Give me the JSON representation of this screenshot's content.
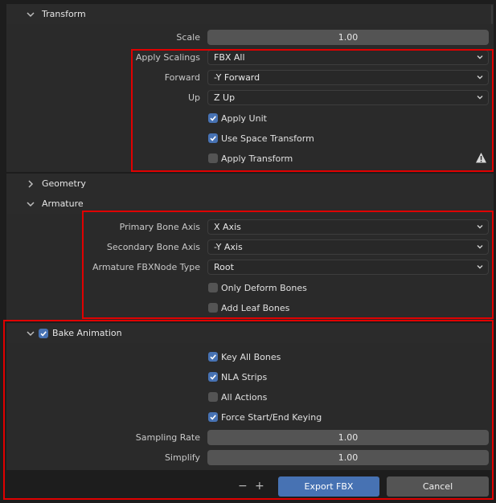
{
  "transform": {
    "title": "Transform",
    "scale": {
      "label": "Scale",
      "value": "1.00"
    },
    "apply_scalings": {
      "label": "Apply Scalings",
      "value": "FBX All"
    },
    "forward": {
      "label": "Forward",
      "value": "-Y Forward"
    },
    "up": {
      "label": "Up",
      "value": "Z Up"
    },
    "apply_unit": {
      "label": "Apply Unit",
      "checked": true
    },
    "use_space_transform": {
      "label": "Use Space Transform",
      "checked": true
    },
    "apply_transform": {
      "label": "Apply Transform",
      "checked": false
    }
  },
  "geometry": {
    "title": "Geometry"
  },
  "armature": {
    "title": "Armature",
    "primary_bone_axis": {
      "label": "Primary Bone Axis",
      "value": "X Axis"
    },
    "secondary_bone_axis": {
      "label": "Secondary Bone Axis",
      "value": "-Y Axis"
    },
    "fbx_node_type": {
      "label": "Armature FBXNode Type",
      "value": "Root"
    },
    "only_deform_bones": {
      "label": "Only Deform Bones",
      "checked": false
    },
    "add_leaf_bones": {
      "label": "Add Leaf Bones",
      "checked": false
    }
  },
  "bake_animation": {
    "title": "Bake Animation",
    "enabled": true,
    "key_all_bones": {
      "label": "Key All Bones",
      "checked": true
    },
    "nla_strips": {
      "label": "NLA Strips",
      "checked": true
    },
    "all_actions": {
      "label": "All Actions",
      "checked": false
    },
    "force_keying": {
      "label": "Force Start/End Keying",
      "checked": true
    },
    "sampling_rate": {
      "label": "Sampling Rate",
      "value": "1.00"
    },
    "simplify": {
      "label": "Simplify",
      "value": "1.00"
    }
  },
  "footer": {
    "minus": "−",
    "plus": "+",
    "export_label": "Export FBX",
    "cancel_label": "Cancel"
  },
  "colors": {
    "accent": "#4772b3",
    "highlight_box": "#e00000",
    "panel_bg": "#2a2a2a",
    "window_bg": "#1d1d1d"
  }
}
